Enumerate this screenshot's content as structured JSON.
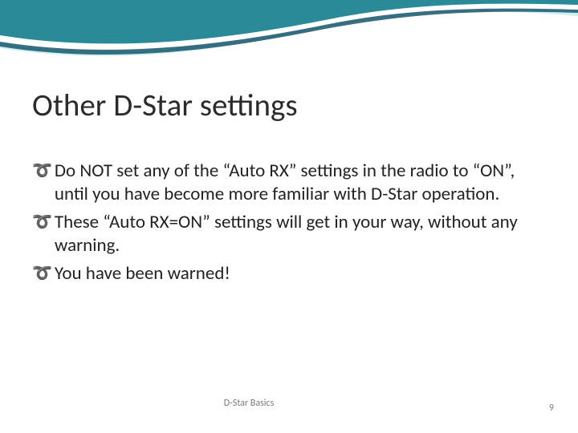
{
  "title": "Other D-Star settings",
  "bullets": [
    "Do NOT set any of the “Auto RX” settings in the radio to “ON”, until you have become more familiar with D-Star operation.",
    "These “Auto RX=ON” settings will get in your way, without any warning.",
    "You have been warned!"
  ],
  "footer": {
    "label": "D-Star Basics",
    "page": "9"
  },
  "colors": {
    "accent": "#2a8a97",
    "wave_dark": "#18566b",
    "wave_light": "#6ac3d4"
  }
}
